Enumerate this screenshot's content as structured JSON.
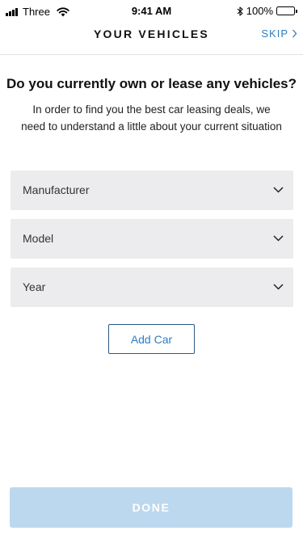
{
  "status_bar": {
    "carrier": "Three",
    "time": "9:41 AM",
    "battery_percent": "100%",
    "battery_level": 1.0,
    "icons": [
      "signal-icon",
      "wifi-icon",
      "bluetooth-icon",
      "battery-icon"
    ]
  },
  "nav": {
    "title": "YOUR VEHICLES",
    "skip_label": "SKIP",
    "skip_icon": "chevron-right-icon"
  },
  "main": {
    "heading": "Do you currently own or lease any vehicles?",
    "description": "In order to find you the best car leasing deals,  we need to understand a little about your current situation",
    "selects": [
      {
        "label": "Manufacturer",
        "icon": "chevron-down-icon"
      },
      {
        "label": "Model",
        "icon": "chevron-down-icon"
      },
      {
        "label": "Year",
        "icon": "chevron-down-icon"
      }
    ],
    "add_car_label": "Add Car"
  },
  "footer": {
    "done_label": "DONE",
    "done_enabled": false
  },
  "colors": {
    "accent": "#2f7dc4",
    "select_bg": "#ececef",
    "done_disabled_bg": "#bcd8ef",
    "add_car_border": "#2b5a84"
  }
}
